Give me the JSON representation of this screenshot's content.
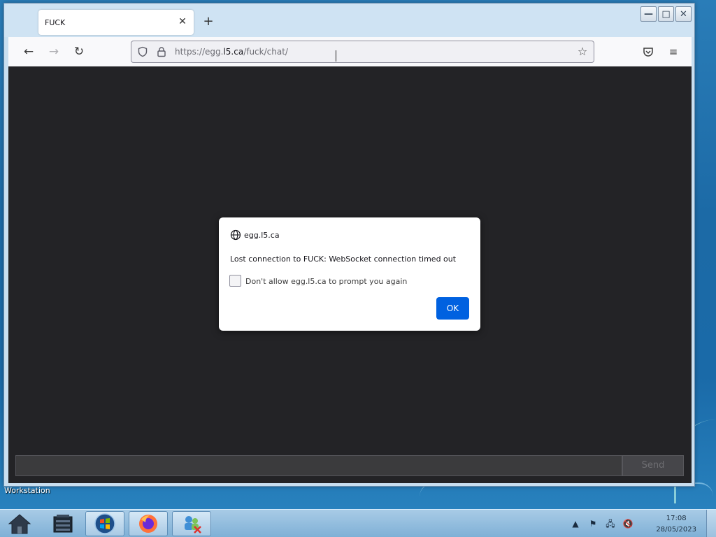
{
  "browser": {
    "tab_title": "FUCK",
    "tab_close": "✕",
    "new_tab": "+",
    "url_prefix": "https://egg.",
    "url_host": "l5.ca",
    "url_path": "/fuck/chat/"
  },
  "window_controls": {
    "minimize": "—",
    "maximize": "□",
    "close": "✕"
  },
  "chat": {
    "input_value": "",
    "send_label": "Send"
  },
  "dialog": {
    "host": "egg.l5.ca",
    "message": "Lost connection to FUCK: WebSocket connection timed out",
    "checkbox_label": "Don't allow egg.l5.ca to prompt you again",
    "checkbox_checked": false,
    "ok_label": "OK"
  },
  "desktop": {
    "label": "Workstation"
  },
  "taskbar": {
    "time": "17:08",
    "date": "28/05/2023"
  },
  "colors": {
    "ok_button": "#0061e0",
    "page_background": "#232326",
    "taskbar": "#7fb0d6"
  }
}
